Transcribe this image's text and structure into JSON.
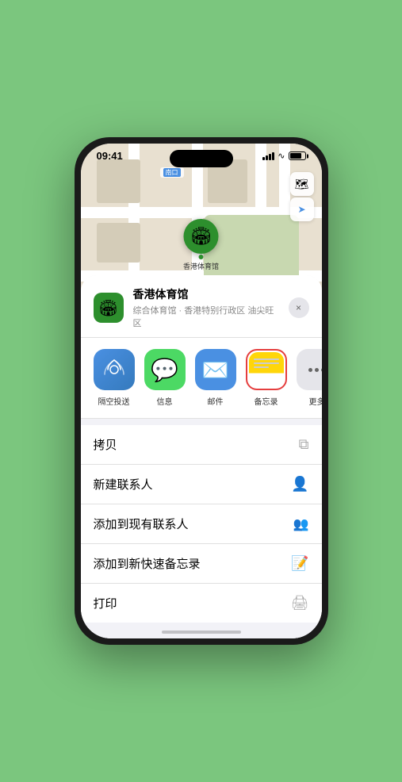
{
  "status": {
    "time": "09:41",
    "location_arrow": "▶"
  },
  "map": {
    "label": "南口",
    "stadium_name": "香港体育馆",
    "stadium_emoji": "🏟"
  },
  "map_controls": {
    "map_btn": "🗺",
    "location_btn": "➤"
  },
  "venue": {
    "name": "香港体育馆",
    "description": "综合体育馆 · 香港特别行政区 油尖旺区",
    "icon": "🏟"
  },
  "share_items": [
    {
      "id": "airdrop",
      "label": "隔空投送"
    },
    {
      "id": "messages",
      "label": "信息"
    },
    {
      "id": "mail",
      "label": "邮件"
    },
    {
      "id": "notes",
      "label": "备忘录"
    },
    {
      "id": "more",
      "label": "更多"
    }
  ],
  "actions": [
    {
      "label": "拷贝",
      "icon": "📋"
    },
    {
      "label": "新建联系人",
      "icon": "👤"
    },
    {
      "label": "添加到现有联系人",
      "icon": "👤"
    },
    {
      "label": "添加到新快速备忘录",
      "icon": "📝"
    },
    {
      "label": "打印",
      "icon": "🖨"
    }
  ],
  "close_label": "×"
}
